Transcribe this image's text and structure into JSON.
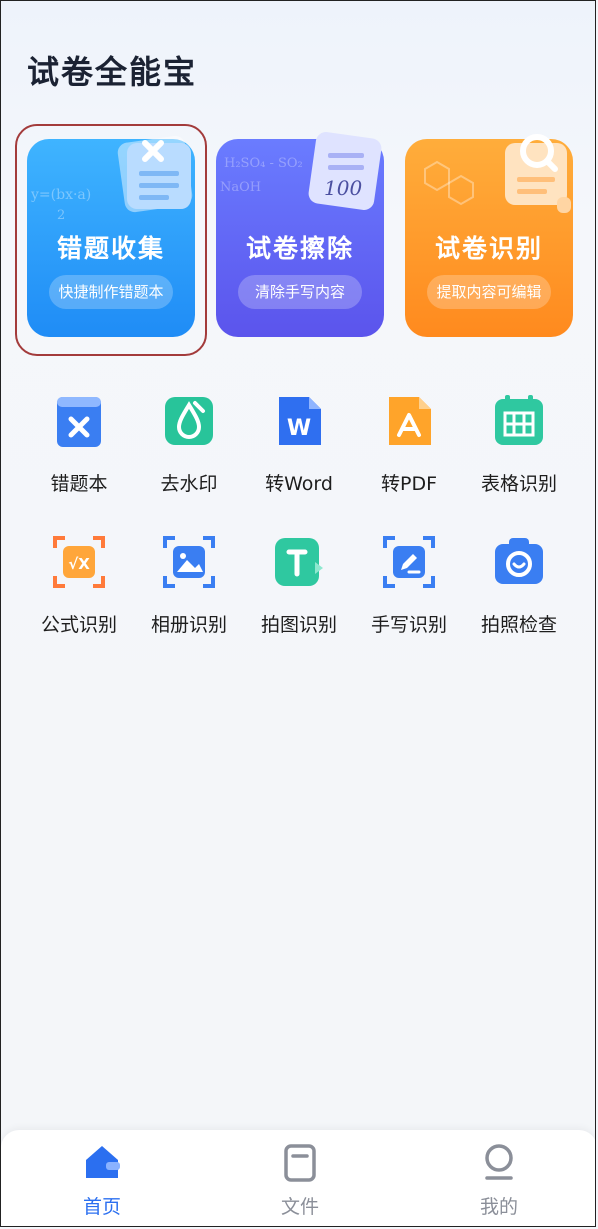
{
  "app": {
    "title": "试卷全能宝"
  },
  "cards": [
    {
      "title": "错题收集",
      "subtitle": "快捷制作错题本",
      "color": "#2496f8"
    },
    {
      "title": "试卷擦除",
      "subtitle": "清除手写内容",
      "color": "#6063f2"
    },
    {
      "title": "试卷识别",
      "subtitle": "提取内容可编辑",
      "color": "#ff9a2a"
    }
  ],
  "tools_row1": [
    {
      "label": "错题本",
      "icon": "wrong-book-icon"
    },
    {
      "label": "去水印",
      "icon": "watermark-remove-icon"
    },
    {
      "label": "转Word",
      "icon": "word-icon"
    },
    {
      "label": "转PDF",
      "icon": "pdf-icon"
    },
    {
      "label": "表格识别",
      "icon": "table-icon"
    }
  ],
  "tools_row2": [
    {
      "label": "公式识别",
      "icon": "formula-icon"
    },
    {
      "label": "相册识别",
      "icon": "album-icon"
    },
    {
      "label": "拍图识别",
      "icon": "text-scan-icon"
    },
    {
      "label": "手写识别",
      "icon": "handwriting-icon"
    },
    {
      "label": "拍照检查",
      "icon": "camera-icon"
    }
  ],
  "nav": [
    {
      "label": "首页",
      "icon": "home-icon",
      "active": true
    },
    {
      "label": "文件",
      "icon": "file-icon",
      "active": false
    },
    {
      "label": "我的",
      "icon": "profile-icon",
      "active": false
    }
  ],
  "colors": {
    "accent": "#2b6ff0",
    "highlight_border": "#a33b3b"
  }
}
